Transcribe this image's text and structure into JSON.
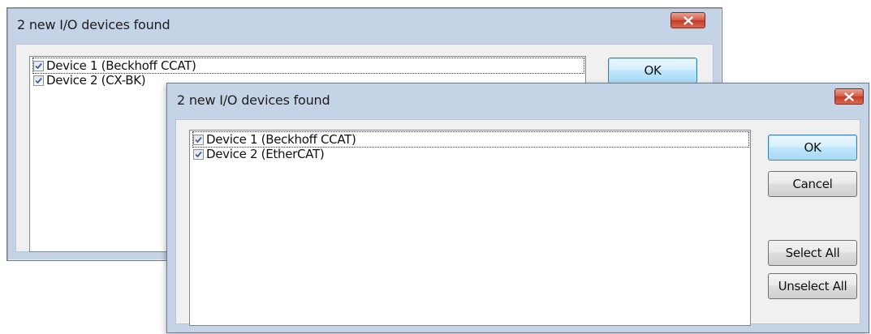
{
  "back_dialog": {
    "title": "2 new I/O devices found",
    "devices": [
      {
        "label": "Device 1 (Beckhoff CCAT)",
        "checked": true
      },
      {
        "label": "Device 2 (CX-BK)",
        "checked": true
      }
    ],
    "ok_label": "OK"
  },
  "front_dialog": {
    "title": "2 new I/O devices found",
    "devices": [
      {
        "label": "Device 1 (Beckhoff CCAT)",
        "checked": true
      },
      {
        "label": "Device 2 (EtherCAT)",
        "checked": true
      }
    ],
    "ok_label": "OK",
    "cancel_label": "Cancel",
    "select_all_label": "Select All",
    "unselect_all_label": "Unselect All"
  },
  "colors": {
    "window_frame": "#c4d3e6",
    "close_button": "#c43b25",
    "default_button": "#bee6fd"
  },
  "icons": [
    "close-icon",
    "checkmark-icon"
  ]
}
